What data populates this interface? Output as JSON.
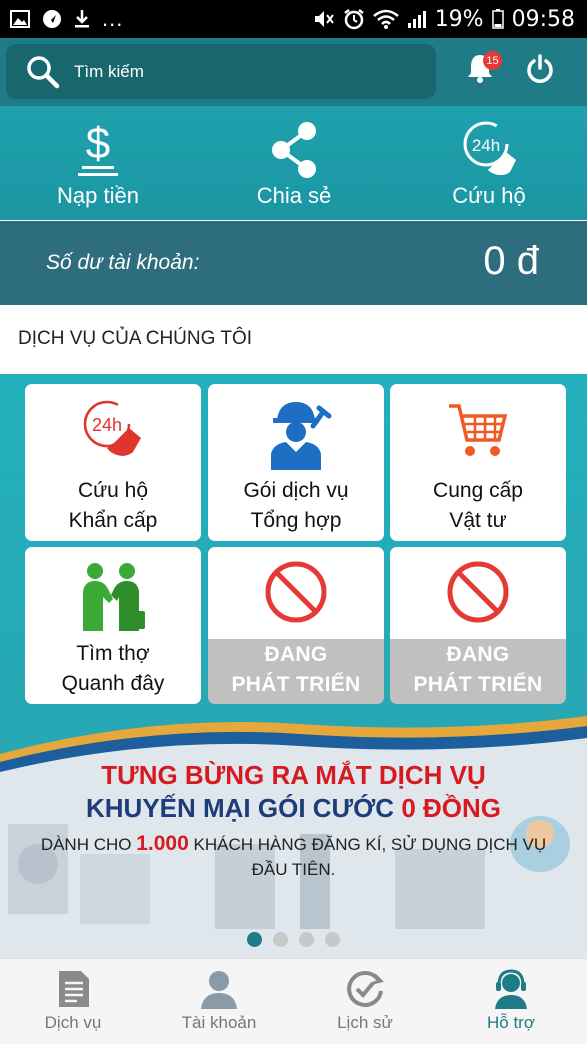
{
  "status_bar": {
    "battery_percent": "19%",
    "time": "09:58",
    "more": "..."
  },
  "header": {
    "search_placeholder": "Tìm kiếm",
    "notification_count": "15"
  },
  "quick_actions": [
    {
      "label": "Nạp tiền",
      "icon": "dollar-icon"
    },
    {
      "label": "Chia sẻ",
      "icon": "share-icon"
    },
    {
      "label": "Cứu hộ",
      "icon": "24h-phone-icon"
    }
  ],
  "balance": {
    "label": "Số dư tài khoản:",
    "value": "0 đ"
  },
  "services": {
    "title": "DỊCH VỤ CỦA CHÚNG TÔI",
    "items": [
      {
        "line1": "Cứu hộ",
        "line2": "Khẩn cấp",
        "icon": "24h-phone-icon"
      },
      {
        "line1": "Gói dịch vụ",
        "line2": "Tổng hợp",
        "icon": "worker-icon"
      },
      {
        "line1": "Cung cấp",
        "line2": "Vật tư",
        "icon": "cart-icon"
      },
      {
        "line1": "Tìm thợ",
        "line2": "Quanh đây",
        "icon": "handshake-icon"
      },
      {
        "line1": "ĐANG",
        "line2": "PHÁT TRIỂN",
        "icon": "prohibited-icon"
      },
      {
        "line1": "ĐANG",
        "line2": "PHÁT TRIỂN",
        "icon": "prohibited-icon"
      }
    ]
  },
  "banner": {
    "line1": "TƯNG BỪNG RA MẮT DỊCH VỤ",
    "line2_prefix": "KHUYẾN MẠI GÓI CƯỚC ",
    "line2_highlight": "0 ĐỒNG",
    "line3_prefix": "DÀNH CHO ",
    "line3_highlight": "1.000",
    "line3_suffix": " KHÁCH HÀNG ĐĂNG KÍ, SỬ DỤNG DỊCH VỤ ĐẦU TIÊN.",
    "slide_count": 4,
    "active_slide": 1
  },
  "bottom_nav": [
    {
      "label": "Dịch vụ",
      "icon": "document-icon"
    },
    {
      "label": "Tài khoản",
      "icon": "user-icon"
    },
    {
      "label": "Lịch sử",
      "icon": "history-check-icon"
    },
    {
      "label": "Hỗ trợ",
      "icon": "support-agent-icon",
      "active": true
    }
  ],
  "colors": {
    "primary": "#1f7c87",
    "accent_red": "#d71920",
    "navy": "#1f3c7a"
  }
}
